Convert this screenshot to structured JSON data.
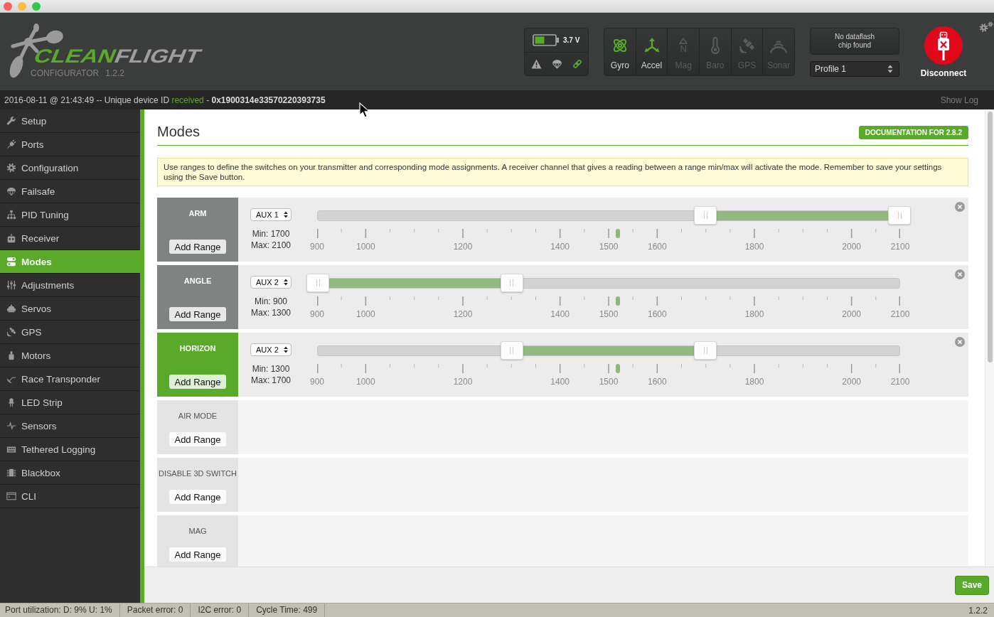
{
  "header": {
    "logo": {
      "wordmark": [
        "CLEAN",
        "FLIGHT"
      ],
      "subtitle": "CONFIGURATOR",
      "version": "1.2.2"
    },
    "battery": {
      "voltage": "3.7 V",
      "indicators": [
        {
          "kind": "warning",
          "on": false
        },
        {
          "kind": "failsafe",
          "on": false
        },
        {
          "kind": "link",
          "on": true
        }
      ]
    },
    "sensors": [
      {
        "kind": "gyro",
        "label": "Gyro",
        "on": true
      },
      {
        "kind": "accel",
        "label": "Accel",
        "on": true
      },
      {
        "kind": "mag",
        "label": "Mag",
        "icon_text": "N",
        "on": false
      },
      {
        "kind": "baro",
        "label": "Baro",
        "on": false
      },
      {
        "kind": "gps",
        "label": "GPS",
        "on": false
      },
      {
        "kind": "sonar",
        "label": "Sonar",
        "on": false
      }
    ],
    "dataflash": "No dataflash chip found",
    "profile": "Profile 1",
    "connection": {
      "label": "Disconnect",
      "connected": true
    }
  },
  "log": {
    "segments": [
      {
        "kind": "plain",
        "text": "2016-08-11 @ 21:43:49 -- Unique device ID "
      },
      {
        "kind": "status",
        "text": "received"
      },
      {
        "kind": "plain",
        "text": " - "
      },
      {
        "kind": "id",
        "text": "0x1900314e33570220393735"
      }
    ],
    "show_log": "Show Log"
  },
  "sidebar": {
    "items": [
      {
        "kind": "setup",
        "label": "Setup",
        "selected": false
      },
      {
        "kind": "ports",
        "label": "Ports",
        "selected": false
      },
      {
        "kind": "configuration",
        "label": "Configuration",
        "selected": false
      },
      {
        "kind": "failsafe",
        "label": "Failsafe",
        "selected": false
      },
      {
        "kind": "pid",
        "label": "PID Tuning",
        "selected": false
      },
      {
        "kind": "receiver",
        "label": "Receiver",
        "selected": false
      },
      {
        "kind": "modes",
        "label": "Modes",
        "selected": true
      },
      {
        "kind": "adjustments",
        "label": "Adjustments",
        "selected": false
      },
      {
        "kind": "servos",
        "label": "Servos",
        "selected": false
      },
      {
        "kind": "gps",
        "label": "GPS",
        "selected": false
      },
      {
        "kind": "motors",
        "label": "Motors",
        "selected": false
      },
      {
        "kind": "transponder",
        "label": "Race Transponder",
        "selected": false
      },
      {
        "kind": "led",
        "label": "LED Strip",
        "selected": false
      },
      {
        "kind": "sensors",
        "label": "Sensors",
        "selected": false
      },
      {
        "kind": "logging",
        "label": "Tethered Logging",
        "selected": false
      },
      {
        "kind": "blackbox",
        "label": "Blackbox",
        "selected": false
      },
      {
        "kind": "cli",
        "label": "CLI",
        "selected": false
      }
    ]
  },
  "page": {
    "title": "Modes",
    "doc_button": "DOCUMENTATION FOR 2.8.2",
    "note": "Use ranges to define the switches on your transmitter and corresponding mode assignments. A receiver channel that gives a reading between a range min/max will activate the mode. Remember to save your settings using the Save button.",
    "modes": [
      {
        "name": "ARM",
        "active": false,
        "add_range": "Add Range",
        "ranges": [
          {
            "channel": "AUX 1",
            "min": "Min: 1700",
            "max": "Max: 2100",
            "handles": [
              {
                "level": 0.6667
              },
              {
                "level": 1
              }
            ],
            "marker": {
              "level": 0.516
            },
            "scale": [
              "900",
              "1000",
              "1200",
              "1400",
              "1500",
              "1600",
              "1800",
              "2000",
              "2100"
            ]
          }
        ]
      },
      {
        "name": "ANGLE",
        "active": false,
        "add_range": "Add Range",
        "ranges": [
          {
            "channel": "AUX 2",
            "min": "Min: 900",
            "max": "Max: 1300",
            "handles": [
              {
                "level": 0
              },
              {
                "level": 0.3333
              }
            ],
            "marker": {
              "level": 0.516
            },
            "scale": [
              "900",
              "1000",
              "1200",
              "1400",
              "1500",
              "1600",
              "1800",
              "2000",
              "2100"
            ]
          }
        ]
      },
      {
        "name": "HORIZON",
        "active": true,
        "add_range": "Add Range",
        "ranges": [
          {
            "channel": "AUX 2",
            "min": "Min: 1300",
            "max": "Max: 1700",
            "handles": [
              {
                "level": 0.3333
              },
              {
                "level": 0.6667
              }
            ],
            "marker": {
              "level": 0.516
            },
            "scale": [
              "900",
              "1000",
              "1200",
              "1400",
              "1500",
              "1600",
              "1800",
              "2000",
              "2100"
            ]
          }
        ]
      },
      {
        "name": "AIR MODE",
        "active": false,
        "add_range": "Add Range"
      },
      {
        "name": "DISABLE 3D SWITCH",
        "active": false,
        "add_range": "Add Range"
      },
      {
        "name": "MAG",
        "active": false,
        "add_range": "Add Range"
      }
    ]
  },
  "save_button": "Save",
  "status_bar": {
    "items": [
      "Port utilization: D: 9% U: 1%",
      "Packet error: 0",
      "I2C error: 0",
      "Cycle Time: 499"
    ],
    "version": "1.2.2"
  }
}
